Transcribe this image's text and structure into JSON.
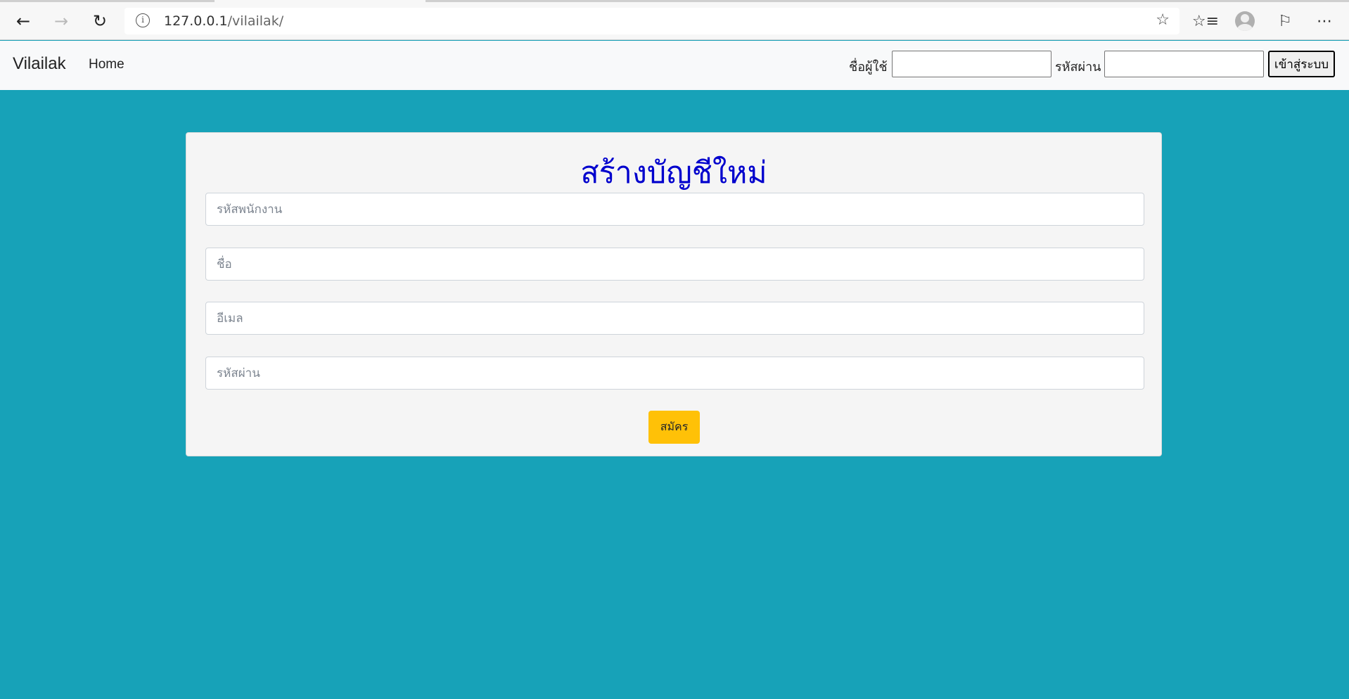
{
  "browser": {
    "url_host": "127.0.0.1",
    "url_path": "/vilailak/",
    "icons": [
      "back-icon",
      "forward-icon",
      "refresh-icon",
      "info-icon",
      "star-icon",
      "favorites-icon",
      "profile-icon",
      "feedback-icon",
      "more-icon"
    ]
  },
  "navbar": {
    "brand": "Vilailak",
    "home": "Home",
    "username_label": "ชื่อผู้ใช้",
    "password_label": "รหัสผ่าน",
    "login_button": "เข้าสู่ระบบ"
  },
  "form": {
    "title": "สร้างบัญชีใหม่",
    "employee_id_placeholder": "รหัสพนักงาน",
    "name_placeholder": "ชื่อ",
    "email_placeholder": "อีเมล",
    "password_placeholder": "รหัสผ่าน",
    "submit_label": "สมัคร"
  },
  "colors": {
    "background": "#17a2b8",
    "title": "#0000cd",
    "submit": "#ffc107"
  }
}
